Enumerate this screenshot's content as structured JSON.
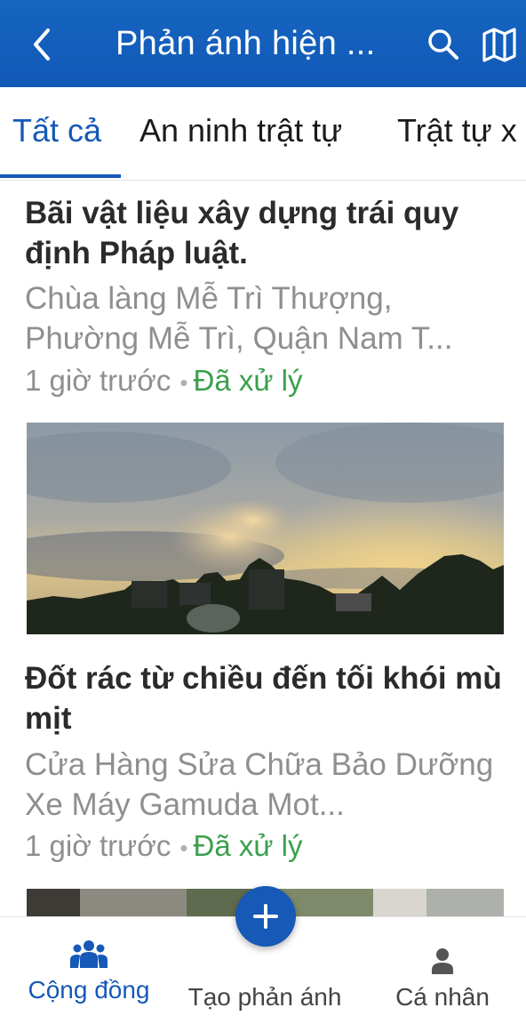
{
  "header": {
    "title": "Phản ánh hiện ...",
    "back_icon": "chevron-left-icon",
    "search_icon": "search-icon",
    "map_icon": "map-icon",
    "background": "#1565c0"
  },
  "tabs": [
    {
      "label": "Tất cả",
      "active": true
    },
    {
      "label": "An ninh trật tự",
      "active": false
    },
    {
      "label": "Trật tự x",
      "active": false
    }
  ],
  "posts": [
    {
      "title": "Bãi vật liệu xây dựng trái quy định Pháp luật.",
      "address": "Chùa làng Mễ Trì Thượng, Phường Mễ Trì, Quận Nam T...",
      "time": "1 giờ trước",
      "separator": "•",
      "status": "Đã xử lý"
    },
    {
      "title": "Đốt rác từ chiều đến tối khói mù mịt",
      "address": "Cửa Hàng Sửa Chữa Bảo Dưỡng Xe Máy Gamuda Mot...",
      "time": "1 giờ trước",
      "separator": "•",
      "status": "Đã xử lý"
    }
  ],
  "bottom_nav": {
    "community": "Cộng đồng",
    "create": "Tạo phản ánh",
    "profile": "Cá nhân"
  },
  "colors": {
    "accent": "#1659b7",
    "status_done": "#3aa04c",
    "muted": "#8f8f8f"
  }
}
